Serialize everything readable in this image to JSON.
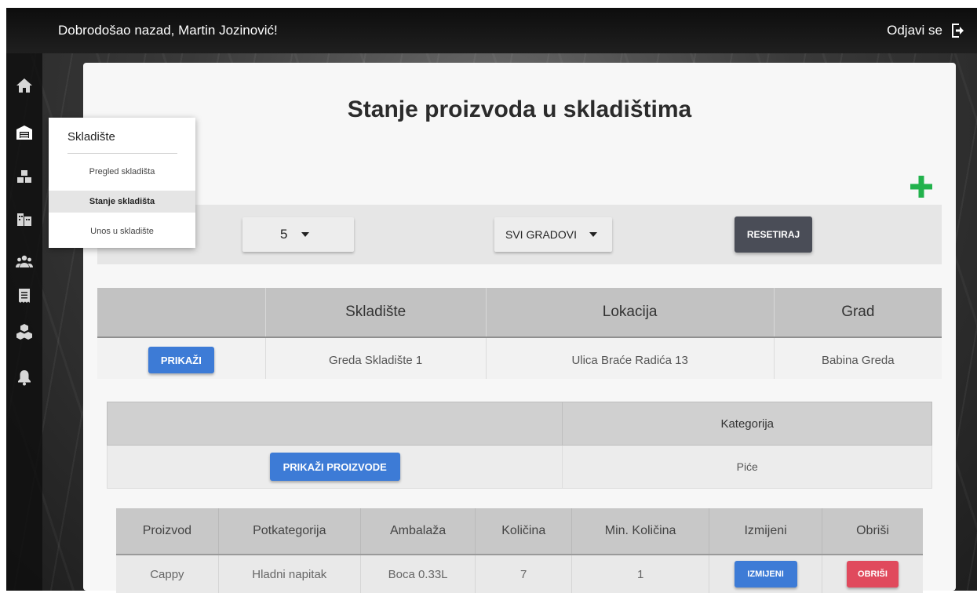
{
  "header": {
    "welcome": "Dobrodošao nazad, Martin Jozinović!",
    "logout_label": "Odjavi se"
  },
  "sidebar": {
    "icons": [
      "home-icon",
      "warehouse-icon",
      "boxes-icon",
      "buildings-icon",
      "users-icon",
      "receipt-icon",
      "packages-icon",
      "bell-icon"
    ]
  },
  "dropdown": {
    "title": "Skladište",
    "items": [
      "Pregled skladišta",
      "Stanje skladišta",
      "Unos u skladište"
    ],
    "active": "Stanje skladišta"
  },
  "page": {
    "title": "Stanje proizvoda u skladištima"
  },
  "filters": {
    "page_size": "5",
    "city": "SVI GRADOVI",
    "reset_label": "RESETIRAJ"
  },
  "warehouses": {
    "columns": [
      "",
      "Skladište",
      "Lokacija",
      "Grad"
    ],
    "rows": [
      {
        "button": "PRIKAŽI",
        "name": "Greda Skladište 1",
        "location": "Ulica Braće Radića 13",
        "city": "Babina Greda"
      }
    ]
  },
  "categories": {
    "columns": [
      "",
      "Kategorija"
    ],
    "rows": [
      {
        "button": "PRIKAŽI PROIZVODE",
        "category": "Piće"
      }
    ]
  },
  "products": {
    "columns": [
      "Proizvod",
      "Potkategorija",
      "Ambalaža",
      "Količina",
      "Min. Količina",
      "Izmijeni",
      "Obriši"
    ],
    "rows": [
      {
        "product": "Cappy",
        "subcategory": "Hladni napitak",
        "packaging": "Boca 0.33L",
        "quantity": "7",
        "min_quantity": "1",
        "edit_label": "IZMIJENI",
        "delete_label": "OBRIŠI"
      }
    ]
  },
  "colors": {
    "primary_blue": "#3d7bd6",
    "danger_red": "#e04a5d",
    "add_green": "#22b24c",
    "reset_dark": "#4a4d57"
  }
}
